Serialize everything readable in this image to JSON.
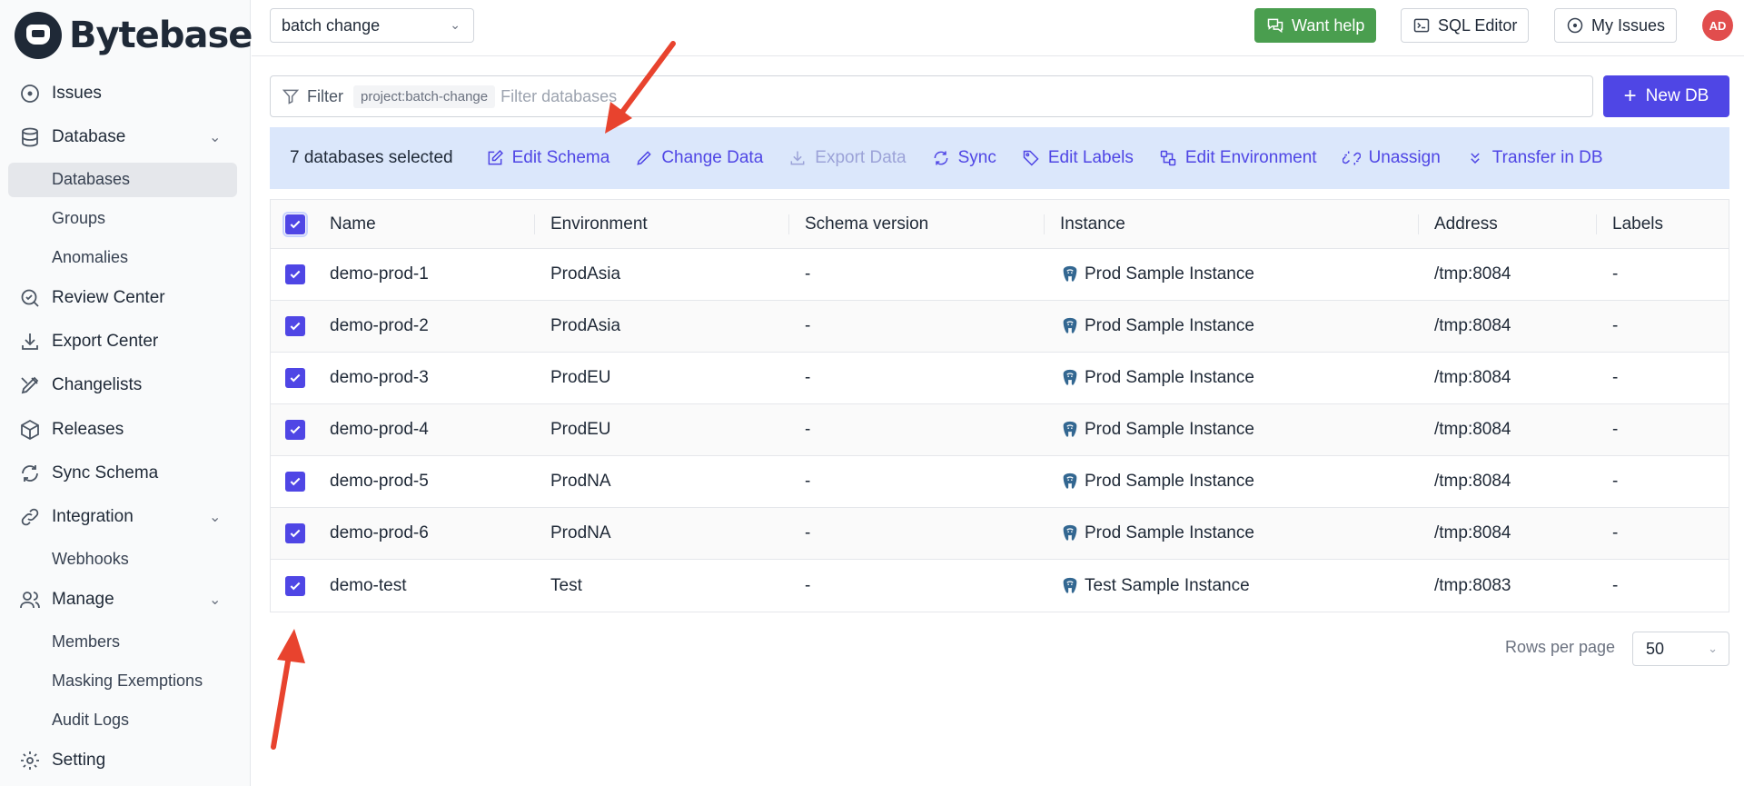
{
  "app": {
    "name": "Bytebase"
  },
  "sidebar": {
    "items": [
      {
        "label": "Issues",
        "icon": "circle-dot-icon"
      },
      {
        "label": "Database",
        "icon": "database-icon",
        "expandable": true
      },
      {
        "label": "Databases",
        "sub": true,
        "active": true
      },
      {
        "label": "Groups",
        "sub": true
      },
      {
        "label": "Anomalies",
        "sub": true
      },
      {
        "label": "Review Center",
        "icon": "review-icon"
      },
      {
        "label": "Export Center",
        "icon": "download-icon"
      },
      {
        "label": "Changelists",
        "icon": "changelist-icon"
      },
      {
        "label": "Releases",
        "icon": "package-icon"
      },
      {
        "label": "Sync Schema",
        "icon": "sync-icon"
      },
      {
        "label": "Integration",
        "icon": "link-icon",
        "expandable": true
      },
      {
        "label": "Webhooks",
        "sub": true
      },
      {
        "label": "Manage",
        "icon": "users-icon",
        "expandable": true
      },
      {
        "label": "Members",
        "sub": true
      },
      {
        "label": "Masking Exemptions",
        "sub": true
      },
      {
        "label": "Audit Logs",
        "sub": true
      },
      {
        "label": "Setting",
        "icon": "gear-icon"
      }
    ]
  },
  "topbar": {
    "project_select": "batch change",
    "want_help": "Want help",
    "sql_editor": "SQL Editor",
    "my_issues": "My Issues",
    "avatar": "AD"
  },
  "filter": {
    "label": "Filter",
    "tag": "project:batch-change",
    "placeholder": "Filter databases"
  },
  "new_db": "New DB",
  "batch": {
    "count_text": "7 databases selected",
    "actions": [
      "Edit Schema",
      "Change Data",
      "Export Data",
      "Sync",
      "Edit Labels",
      "Edit Environment",
      "Unassign",
      "Transfer in DB"
    ]
  },
  "table": {
    "columns": [
      "Name",
      "Environment",
      "Schema version",
      "Instance",
      "Address",
      "Labels"
    ],
    "rows": [
      {
        "name": "demo-prod-1",
        "environment": "ProdAsia",
        "schema_version": "-",
        "instance": "Prod Sample Instance",
        "address": "/tmp:8084",
        "labels": "-"
      },
      {
        "name": "demo-prod-2",
        "environment": "ProdAsia",
        "schema_version": "-",
        "instance": "Prod Sample Instance",
        "address": "/tmp:8084",
        "labels": "-"
      },
      {
        "name": "demo-prod-3",
        "environment": "ProdEU",
        "schema_version": "-",
        "instance": "Prod Sample Instance",
        "address": "/tmp:8084",
        "labels": "-"
      },
      {
        "name": "demo-prod-4",
        "environment": "ProdEU",
        "schema_version": "-",
        "instance": "Prod Sample Instance",
        "address": "/tmp:8084",
        "labels": "-"
      },
      {
        "name": "demo-prod-5",
        "environment": "ProdNA",
        "schema_version": "-",
        "instance": "Prod Sample Instance",
        "address": "/tmp:8084",
        "labels": "-"
      },
      {
        "name": "demo-prod-6",
        "environment": "ProdNA",
        "schema_version": "-",
        "instance": "Prod Sample Instance",
        "address": "/tmp:8084",
        "labels": "-"
      },
      {
        "name": "demo-test",
        "environment": "Test",
        "schema_version": "-",
        "instance": "Test Sample Instance",
        "address": "/tmp:8083",
        "labels": "-"
      }
    ]
  },
  "pager": {
    "label": "Rows per page",
    "value": "50"
  },
  "colors": {
    "primary": "#4f46e5",
    "help_green": "#4a9e4f",
    "batch_bg": "#dbe7fb",
    "annotation_arrow": "#e8432e",
    "avatar": "#e14d4d"
  }
}
